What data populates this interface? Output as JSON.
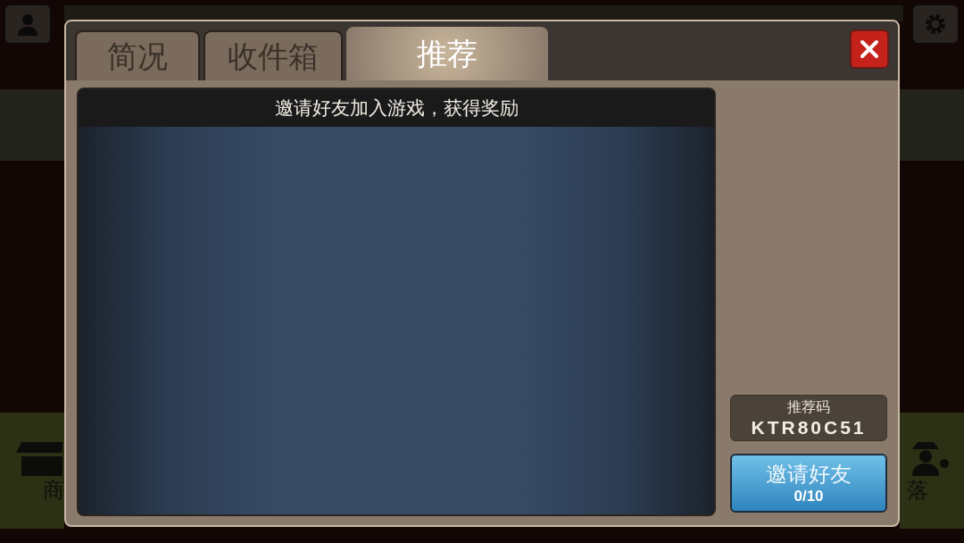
{
  "background": {
    "nav_left": {
      "label": "商"
    },
    "nav_right": {
      "label": "落"
    }
  },
  "dialog": {
    "tabs": [
      {
        "label": "简况",
        "selected": false
      },
      {
        "label": "收件箱",
        "selected": false
      },
      {
        "label": "推荐",
        "selected": true
      }
    ],
    "panel_title": "邀请好友加入游戏，获得奖励",
    "referral_code": {
      "label": "推荐码",
      "value": "KTR80C51"
    },
    "invite_button": {
      "label": "邀请好友",
      "count": "0/10"
    }
  }
}
